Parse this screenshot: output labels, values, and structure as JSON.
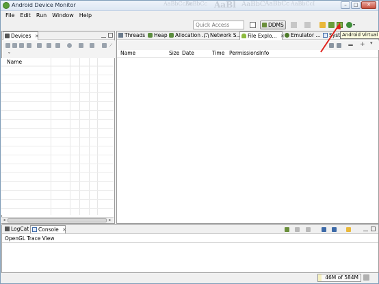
{
  "window": {
    "title": "Android Device Monitor",
    "ghost_texts": [
      "AaBbCcDc",
      "AaBbCc",
      "AaBl",
      "AaBbC",
      "AaBbCc",
      "AaBbCcI"
    ]
  },
  "menubar": [
    "File",
    "Edit",
    "Run",
    "Window",
    "Help"
  ],
  "toolbar": {
    "quick_access_placeholder": "Quick Access",
    "perspective_label": "DDMS",
    "tooltip": "Android Virtual De"
  },
  "devices_panel": {
    "tab_label": "Devices",
    "close_glyph": "✕",
    "column_name": "Name"
  },
  "main_tabs": [
    {
      "label": "Threads",
      "icon": "threads-icon"
    },
    {
      "label": "Heap",
      "icon": "heap-icon"
    },
    {
      "label": "Allocation ...",
      "icon": "allocation-icon"
    },
    {
      "label": "Network S...",
      "icon": "network-icon"
    },
    {
      "label": "File Explo...",
      "icon": "android-icon",
      "active": true,
      "close": "✕"
    },
    {
      "label": "Emulator ...",
      "icon": "emulator-icon"
    },
    {
      "label": "Syste",
      "icon": "system-icon"
    }
  ],
  "file_explorer": {
    "columns": [
      "Name",
      "Size",
      "Date",
      "Time",
      "Permissions",
      "Info"
    ]
  },
  "bottom_panel": {
    "tabs": [
      {
        "label": "LogCat",
        "icon": "logcat-icon"
      },
      {
        "label": "Console",
        "icon": "console-icon",
        "active": true,
        "close": "✕"
      }
    ],
    "console_title": "OpenGL Trace View"
  },
  "status": {
    "memory": "46M of 584M"
  },
  "colors": {
    "annotation_arrow": "#e0201a",
    "ddms_green": "#6a8f3b",
    "tab_active_bg": "#ffffff"
  }
}
